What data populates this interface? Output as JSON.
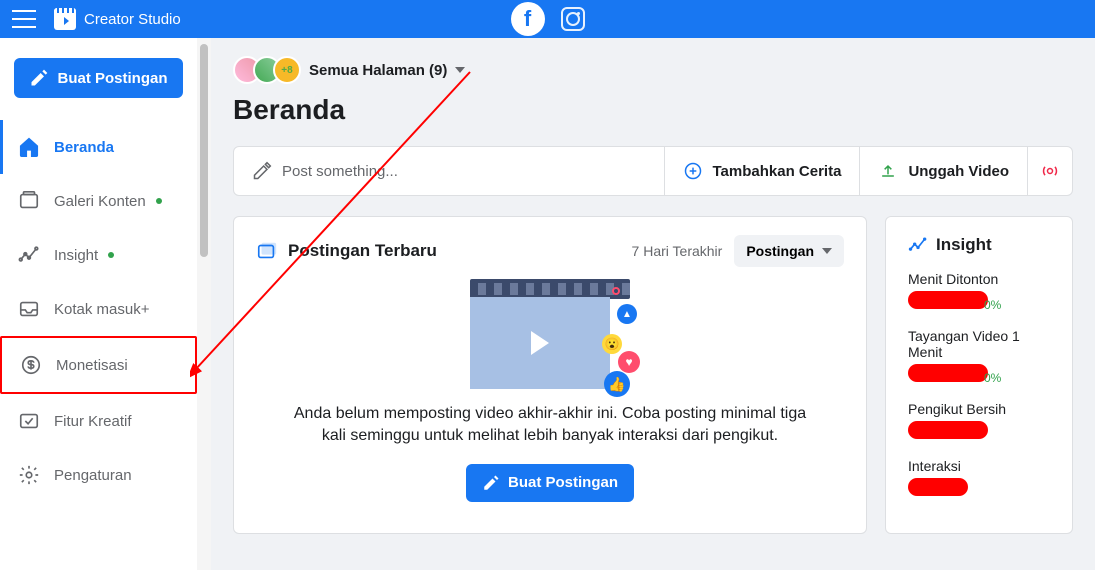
{
  "header": {
    "brand": "Creator Studio"
  },
  "sidebar": {
    "compose_label": "Buat Postingan",
    "items": [
      {
        "label": "Beranda"
      },
      {
        "label": "Galeri Konten"
      },
      {
        "label": "Insight"
      },
      {
        "label": "Kotak masuk+"
      },
      {
        "label": "Monetisasi"
      },
      {
        "label": "Fitur Kreatif"
      },
      {
        "label": "Pengaturan"
      }
    ]
  },
  "page": {
    "avatar_more": "+8",
    "selector_label": "Semua Halaman (9)",
    "title": "Beranda"
  },
  "action_bar": {
    "post_something": "Post something...",
    "add_story": "Tambahkan Cerita",
    "upload_video": "Unggah Video"
  },
  "posts": {
    "title": "Postingan Terbaru",
    "range": "7 Hari Terakhir",
    "dropdown": "Postingan",
    "empty": "Anda belum memposting video akhir-akhir ini. Coba posting minimal tiga kali seminggu untuk melihat lebih banyak interaksi dari pengikut.",
    "cta": "Buat Postingan"
  },
  "insight": {
    "title": "Insight",
    "metrics": [
      {
        "label": "Menit Ditonton"
      },
      {
        "label": "Tayangan Video 1 Menit"
      },
      {
        "label": "Pengikut Bersih"
      },
      {
        "label": "Interaksi"
      }
    ],
    "pct": "0%"
  }
}
